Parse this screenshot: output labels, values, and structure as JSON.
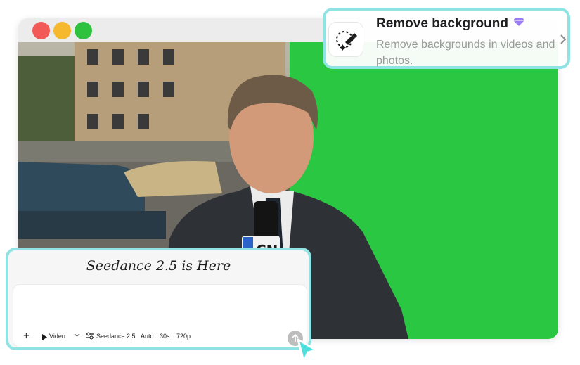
{
  "window": {
    "controls": [
      "close",
      "minimize",
      "maximize"
    ],
    "colors": {
      "close": "#f15a57",
      "minimize": "#f6b82f",
      "maximize": "#2fc23f",
      "green_screen": "#2ac742"
    }
  },
  "preview": {
    "mic_badge_text": "CN"
  },
  "remove_background": {
    "title": "Remove background",
    "description": "Remove backgrounds in videos and photos.",
    "icon": "magic-wand-icon",
    "badge_icon": "gem-icon",
    "badge_color": "#9b7bf2"
  },
  "prompt": {
    "title": "Seedance 2.5 is Here",
    "toolbar": {
      "add": "+",
      "mode": "Video",
      "model": "Seedance 2.5",
      "aspect": "Auto",
      "duration": "30s",
      "resolution": "720p"
    },
    "send_icon": "arrow-up-icon"
  }
}
